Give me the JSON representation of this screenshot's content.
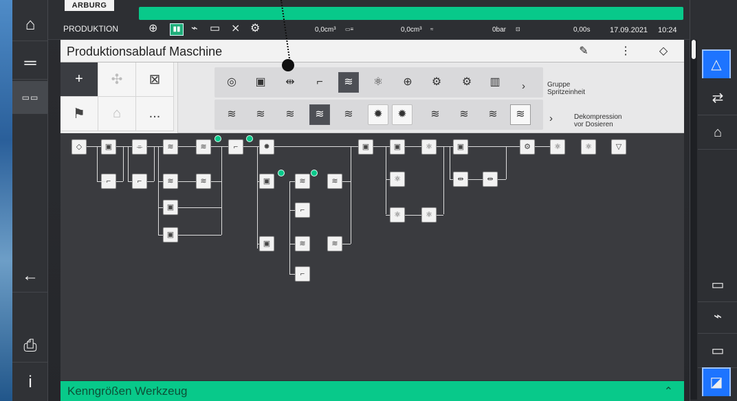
{
  "app": {
    "brand": "ARBURG",
    "section": "PRODUKTION",
    "window_title": "Produktionsablauf Maschine",
    "bottom_title": "Kenngrößen Werkzeug"
  },
  "topbar": {
    "metrics": [
      {
        "label": "0,0cm³"
      },
      {
        "label": "0,0cm³"
      },
      {
        "label": "0bar"
      },
      {
        "label": "0,00s"
      }
    ],
    "date": "17.09.2021",
    "time": "10:24"
  },
  "toolbar": {
    "group_1": "Gruppe Spritzeinheit",
    "group_2": "Dekompression vor Dosieren",
    "left_more": "..."
  },
  "icons": {
    "home": "home-icon",
    "menu": "menu-icon",
    "machine": "machine-icon",
    "back": "back-arrow-icon",
    "print": "printer-icon",
    "info": "info-icon",
    "edit": "pencil-icon",
    "tree": "tree-icon",
    "collapse": "collapse-icon",
    "camera": "camera-icon",
    "globe": "globe-icon"
  },
  "colors": {
    "accent_green": "#08c98a",
    "accent_blue": "#1d74ff"
  }
}
